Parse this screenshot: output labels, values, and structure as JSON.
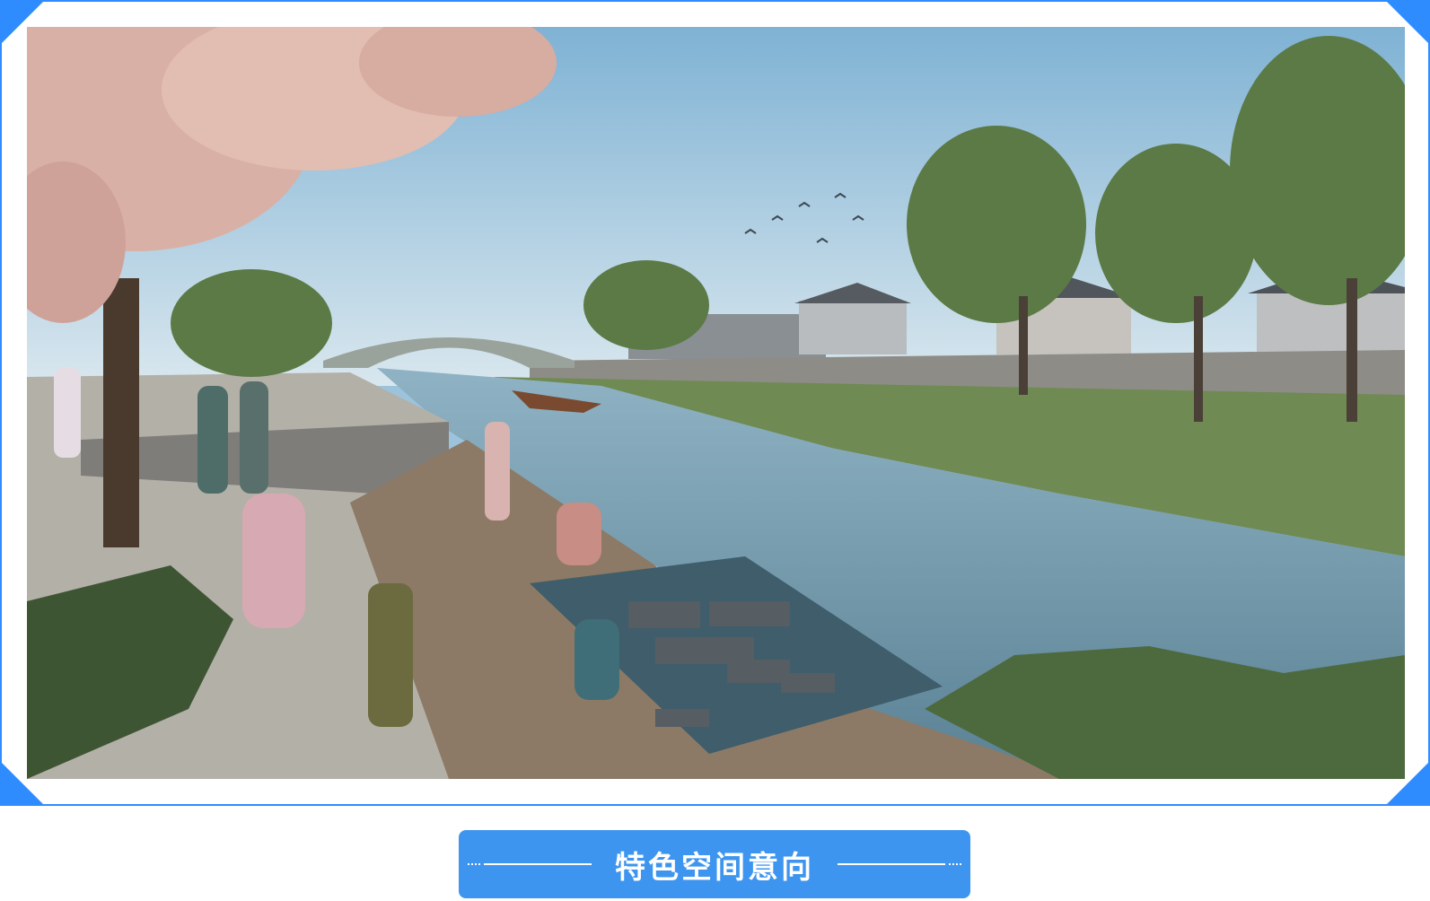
{
  "caption": {
    "title": "特色空间意向"
  },
  "colors": {
    "accent": "#2f8cff",
    "caption_bg": "#3d95ef",
    "caption_text": "#ffffff"
  }
}
